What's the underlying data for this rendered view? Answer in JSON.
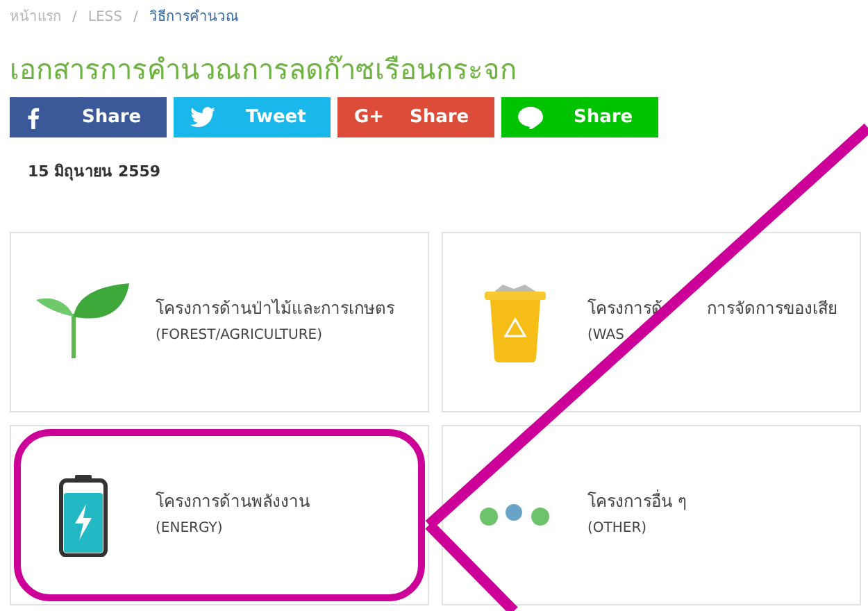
{
  "breadcrumb": [
    {
      "label": "หน้าแรก",
      "selected": false
    },
    {
      "label": "LESS",
      "selected": false
    },
    {
      "label": "วิธีการคำนวณ",
      "selected": true
    }
  ],
  "breadcrumb_separator": "/",
  "title": "เอกสารการคำนวณการลดก๊าซเรือนกระจก",
  "share_buttons": [
    {
      "kind": "facebook",
      "label": "Share"
    },
    {
      "kind": "twitter",
      "label": "Tweet"
    },
    {
      "kind": "google",
      "label": "Share",
      "icon_text": "G+"
    },
    {
      "kind": "line",
      "label": "Share"
    }
  ],
  "date": "15 มิถุนายน 2559",
  "categories": [
    {
      "kind": "plant",
      "title": "โครงการด้านป่าไม้และการเกษตร",
      "subtitle": "(FOREST/AGRICULTURE)",
      "highlighted": false
    },
    {
      "kind": "bin",
      "title_parts": [
        "โครงการด้",
        "การจัดการของเสีย"
      ],
      "subtitle": "(WAS",
      "highlighted": false
    },
    {
      "kind": "battery",
      "title": "โครงการด้านพลังงาน",
      "subtitle": "(ENERGY)",
      "highlighted": true
    },
    {
      "kind": "dots",
      "title": "โครงการอื่น ๆ",
      "subtitle": "(OTHER)",
      "highlighted": false
    }
  ]
}
